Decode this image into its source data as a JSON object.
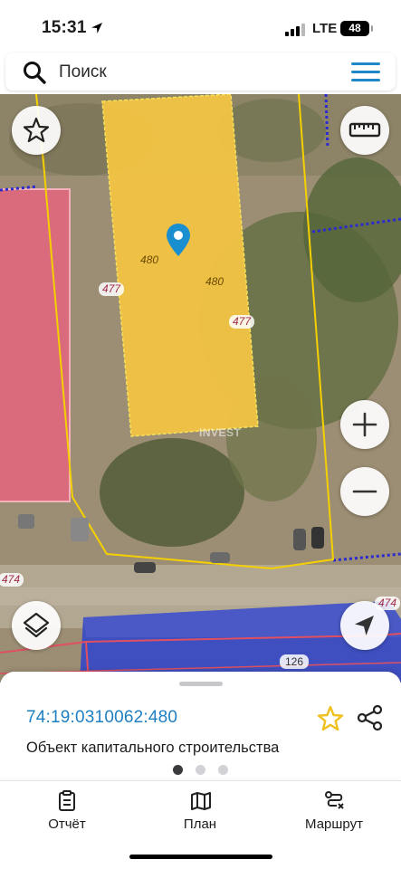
{
  "status_bar": {
    "time": "15:31",
    "network": "LTE",
    "battery": "48"
  },
  "search": {
    "placeholder": "Поиск",
    "search_icon": "search-icon",
    "menu_icon": "hamburger-menu-icon"
  },
  "map": {
    "parcel_labels": [
      "480",
      "480"
    ],
    "boundary_labels": [
      "477",
      "477",
      "474",
      "474"
    ],
    "building_label": "126",
    "watermark": "INVEST",
    "controls": {
      "favorite_icon": "star-outline-icon",
      "ruler_icon": "ruler-icon",
      "zoom_in_icon": "plus-icon",
      "zoom_out_icon": "minus-icon",
      "layers_icon": "layers-icon",
      "locate_icon": "navigation-arrow-icon"
    },
    "colors": {
      "parcel_fill": "#f2c443",
      "building_red": "#d96b7c",
      "building_blue": "#3f4fc0",
      "boundary_blue": "#2a2ad0",
      "boundary_yellow": "#f5d000",
      "marker": "#1a8fd0"
    }
  },
  "details": {
    "cadastral_number": "74:19:0310062:480",
    "object_type": "Объект капитального строительства",
    "pager": {
      "pages": 3,
      "active": 1
    },
    "colors": {
      "link": "#1e7fc2",
      "star": "#f0c020"
    }
  },
  "tabs": [
    {
      "label": "Отчёт",
      "icon": "clipboard-icon"
    },
    {
      "label": "План",
      "icon": "map-icon"
    },
    {
      "label": "Маршрут",
      "icon": "route-icon"
    }
  ]
}
